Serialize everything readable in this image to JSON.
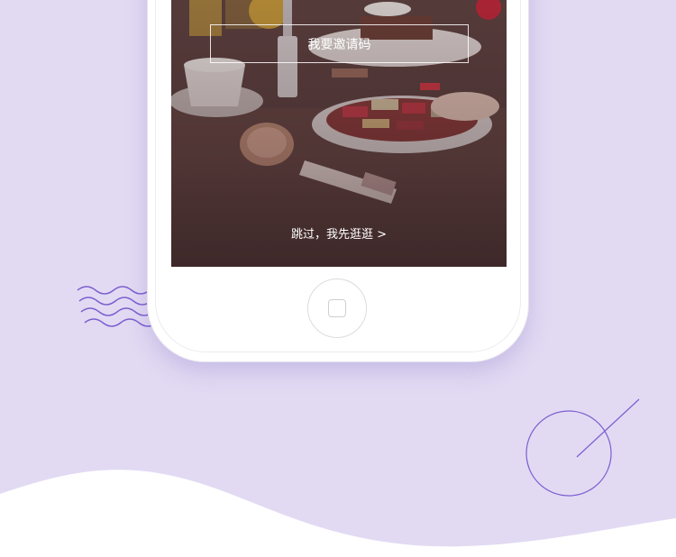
{
  "colors": {
    "background": "#e2daf3",
    "wave": "#ffffff",
    "accent_line": "#7c5fcf"
  },
  "onboarding": {
    "invite_button_label": "我要邀请码",
    "skip_label": "跳过，我先逛逛 >"
  },
  "icons": {
    "home": "home-button-icon",
    "wavy": "wavy-lines-decoration",
    "circle": "circle-line-decoration"
  }
}
